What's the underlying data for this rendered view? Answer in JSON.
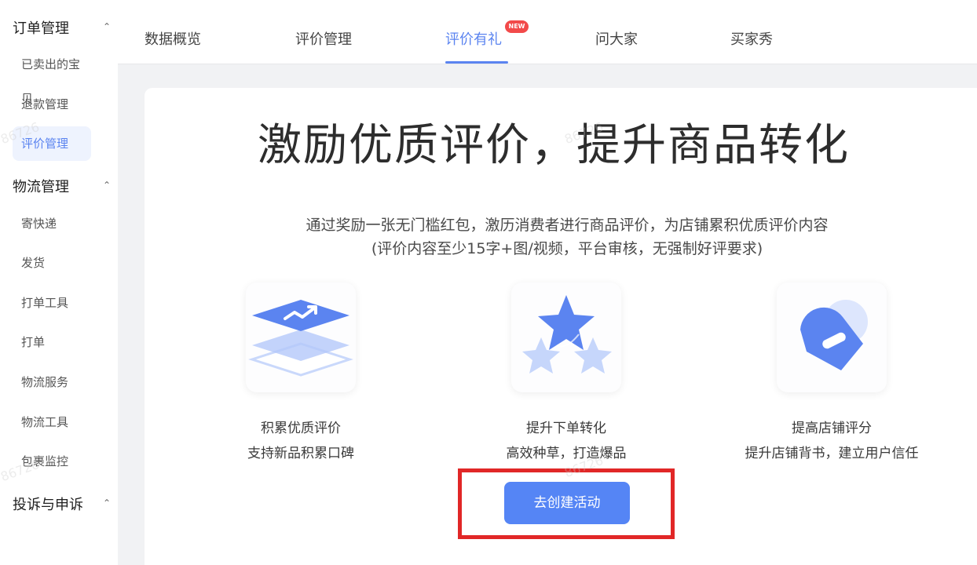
{
  "sidebar": {
    "groups": [
      {
        "title": "订单管理",
        "chevron": "chevron-up-icon"
      },
      {
        "title": "物流管理",
        "chevron": "chevron-up-icon"
      },
      {
        "title": "投诉与申诉",
        "chevron": "chevron-up-icon"
      }
    ],
    "items": [
      {
        "label": "已卖出的宝贝"
      },
      {
        "label": "退款管理"
      },
      {
        "label": "评价管理",
        "active": true
      },
      {
        "label": "寄快递"
      },
      {
        "label": "发货"
      },
      {
        "label": "打单工具"
      },
      {
        "label": "打单"
      },
      {
        "label": "物流服务"
      },
      {
        "label": "物流工具"
      },
      {
        "label": "包裹监控"
      }
    ]
  },
  "tabs": [
    {
      "label": "数据概览"
    },
    {
      "label": "评价管理"
    },
    {
      "label": "评价有礼",
      "active": true,
      "badge": "NEW"
    },
    {
      "label": "问大家"
    },
    {
      "label": "买家秀"
    }
  ],
  "main": {
    "title": "激励优质评价，提升商品转化",
    "subtitle_line1": "通过奖励一张无门槛红包，激历消费者进行商品评价，为店铺累积优质评价内容",
    "subtitle_line2": "(评价内容至少15字+图/视频，平台审核，无强制好评要求)",
    "features": [
      {
        "icon": "growth-layers-icon",
        "title": "积累优质评价",
        "desc": "支持新品积累口碑"
      },
      {
        "icon": "star-icon",
        "title": "提升下单转化",
        "desc": "高效种草，打造爆品"
      },
      {
        "icon": "shield-icon",
        "title": "提高店铺评分",
        "desc": "提升店铺背书，建立用户信任"
      }
    ],
    "cta_label": "去创建活动"
  },
  "watermark": {
    "text": "86726"
  },
  "colors": {
    "accent": "#5b84f0",
    "cta": "#5585f5",
    "highlight": "#e12727",
    "badge": "#f24a4a"
  }
}
